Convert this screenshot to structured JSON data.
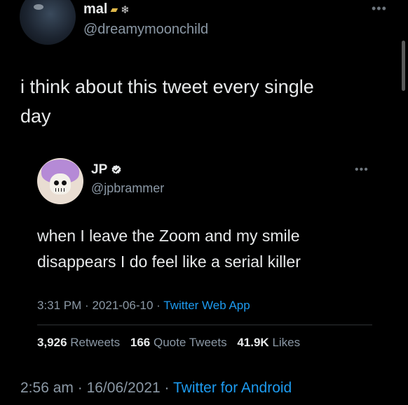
{
  "colors": {
    "background": "#000000",
    "text": "#e7e9ea",
    "muted": "#8b98a5",
    "link": "#1d9bf0"
  },
  "main_tweet": {
    "display_name": "mal",
    "name_emojis": [
      "gold-bar-emoji",
      "snowflake-emoji"
    ],
    "handle": "@dreamymoonchild",
    "more_icon": "more-dots-icon",
    "text_line1": "i think about this tweet every single",
    "text_line2": "day",
    "time": "2:56 am",
    "date": "16/06/2021",
    "source": "Twitter for Android",
    "separator": "·"
  },
  "quoted_tweet": {
    "display_name": "JP",
    "verified_icon": "verified-badge-icon",
    "handle": "@jpbrammer",
    "more_icon": "more-dots-icon",
    "text_line1": "when I leave the Zoom and my smile",
    "text_line2": "disappears I do feel like a serial killer",
    "time": "3:31 PM",
    "date": "2021-06-10",
    "source": "Twitter Web App",
    "separator": "·",
    "stats": {
      "retweets_count": "3,926",
      "retweets_label": "Retweets",
      "quotes_count": "166",
      "quotes_label": "Quote Tweets",
      "likes_count": "41.9K",
      "likes_label": "Likes"
    }
  }
}
